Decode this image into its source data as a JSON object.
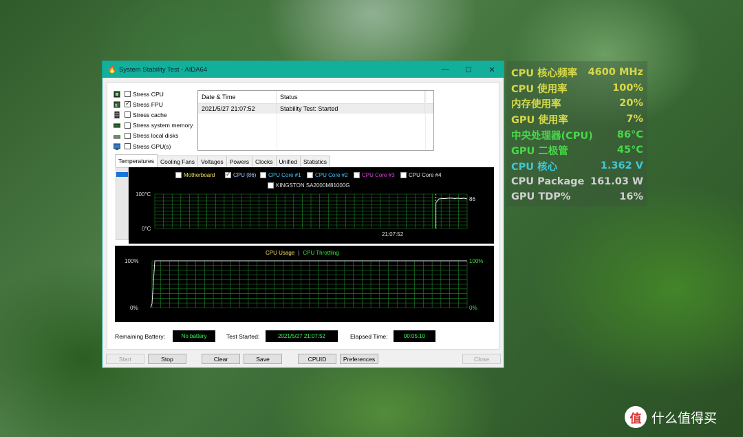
{
  "window": {
    "title": "System Stability Test - AIDA64",
    "minimize": "—",
    "maximize": "☐",
    "close": "✕"
  },
  "stress": [
    {
      "label": "Stress CPU",
      "checked": false,
      "icon": "cpu-icon"
    },
    {
      "label": "Stress FPU",
      "checked": true,
      "icon": "fpu-icon"
    },
    {
      "label": "Stress cache",
      "checked": false,
      "icon": "cache-icon"
    },
    {
      "label": "Stress system memory",
      "checked": false,
      "icon": "memory-icon"
    },
    {
      "label": "Stress local disks",
      "checked": false,
      "icon": "disk-icon"
    },
    {
      "label": "Stress GPU(s)",
      "checked": false,
      "icon": "monitor-icon"
    }
  ],
  "status_table": {
    "headers": [
      "Date & Time",
      "Status"
    ],
    "rows": [
      [
        "2021/5/27 21:07:52",
        "Stability Test: Started"
      ]
    ]
  },
  "tabs": [
    "Temperatures",
    "Cooling Fans",
    "Voltages",
    "Powers",
    "Clocks",
    "Unified",
    "Statistics"
  ],
  "temp_legend": [
    {
      "label": "Motherboard",
      "checked": false,
      "color": "#f0e060"
    },
    {
      "label": "CPU (86)",
      "checked": true,
      "color": "#a0c8ff"
    },
    {
      "label": "CPU Core #1",
      "checked": false,
      "color": "#40c8ff"
    },
    {
      "label": "CPU Core #2",
      "checked": false,
      "color": "#40c8ff"
    },
    {
      "label": "CPU Core #3",
      "checked": false,
      "color": "#e040e0"
    },
    {
      "label": "CPU Core #4",
      "checked": false,
      "color": "#e0e0e0"
    },
    {
      "label": "KINGSTON SA2000M81000G",
      "checked": false,
      "color": "#e0e0e0"
    }
  ],
  "usage_legend": {
    "usage": "CPU Usage",
    "sep": "|",
    "throttling": "CPU Throttling"
  },
  "chart_data": [
    {
      "type": "line",
      "title": "Temperatures",
      "series": [
        {
          "name": "CPU (86)",
          "x": [
            "21:07:52"
          ],
          "values": [
            86
          ]
        }
      ],
      "ylim": [
        0,
        100
      ],
      "ytick_labels": [
        "100°C",
        "0°C"
      ],
      "xtick_labels": [
        "21:07:52"
      ],
      "last_value_label": "86",
      "grid": true,
      "profile": {
        "start_fraction": 0.9,
        "values": [
          75,
          86,
          87,
          87,
          88,
          88,
          87,
          88,
          87,
          88,
          86
        ]
      }
    },
    {
      "type": "line",
      "series": [
        {
          "name": "CPU Usage",
          "values": [
            0,
            100,
            100,
            100,
            100,
            100,
            100,
            100,
            100,
            100,
            100
          ]
        },
        {
          "name": "CPU Throttling",
          "values": [
            0,
            0,
            0,
            0,
            0,
            0,
            0,
            0,
            0,
            0,
            0
          ]
        }
      ],
      "ylim": [
        0,
        100
      ],
      "ytick_labels_left": [
        "100%",
        "0%"
      ],
      "ytick_labels_right": [
        "100%",
        "0%"
      ],
      "grid": true
    }
  ],
  "info": {
    "battery_label": "Remaining Battery:",
    "battery_value": "No battery",
    "started_label": "Test Started:",
    "started_value": "2021/5/27 21:07:52",
    "elapsed_label": "Elapsed Time:",
    "elapsed_value": "00:05:10"
  },
  "buttons": {
    "start": "Start",
    "stop": "Stop",
    "clear": "Clear",
    "save": "Save",
    "cpuid": "CPUID",
    "preferences": "Preferences",
    "close": "Close"
  },
  "overlay": [
    {
      "label": "CPU 核心频率",
      "value": "4600 MHz",
      "color": "#d8d848"
    },
    {
      "label": "CPU 使用率",
      "value": "100%",
      "color": "#d8d848"
    },
    {
      "label": "内存使用率",
      "value": "20%",
      "color": "#d8d848"
    },
    {
      "label": "GPU 使用率",
      "value": "7%",
      "color": "#d8d848"
    },
    {
      "label": "中央处理器(CPU)",
      "value": "86°C",
      "color": "#48d848"
    },
    {
      "label": "GPU 二极管",
      "value": "45°C",
      "color": "#48d848"
    },
    {
      "label": "CPU 核心",
      "value": "1.362 V",
      "color": "#40c8d8"
    },
    {
      "label": "CPU Package",
      "value": "161.03 W",
      "color": "#d0d0d0"
    },
    {
      "label": "GPU TDP%",
      "value": "16%",
      "color": "#d0d0d0"
    }
  ],
  "brand": {
    "logo": "值",
    "text": "什么值得买"
  }
}
